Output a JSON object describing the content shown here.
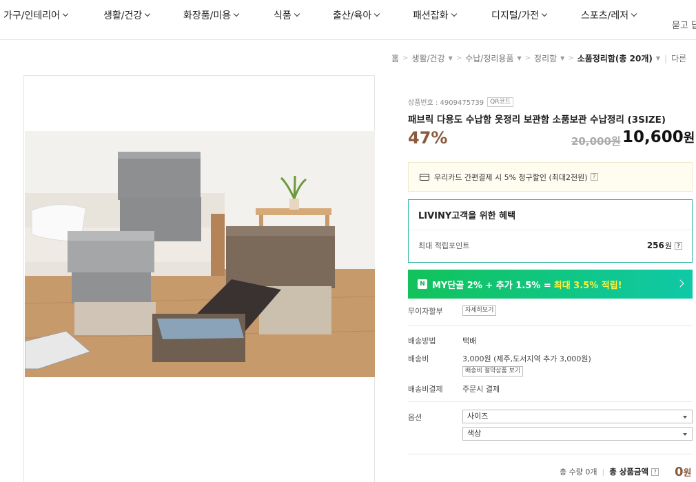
{
  "nav": {
    "items": [
      {
        "label": "가구/인테리어"
      },
      {
        "label": "생활/건강"
      },
      {
        "label": "화장품/미용"
      },
      {
        "label": "식품"
      },
      {
        "label": "출산/육아"
      },
      {
        "label": "패션잡화"
      },
      {
        "label": "디지털/가전"
      },
      {
        "label": "스포츠/레저"
      }
    ],
    "extra": "묻고 답"
  },
  "breadcrumb": {
    "home": "홈",
    "level1": "생활/건강",
    "level2": "수납/정리용품",
    "level3": "정리함",
    "current_prefix": "소품정리함(총 ",
    "current_count": "20",
    "current_suffix": "개)",
    "other": "다른"
  },
  "product": {
    "code_label": "상품번호 : 4909475739",
    "qr_label": "QR코드",
    "title": "패브릭 다용도 수납함 옷정리 보관함 소품보관 수납정리 (3SIZE)",
    "discount": "47%",
    "original_price": "20,000원",
    "price": "10,600",
    "price_unit": "원",
    "image_alt": "fabric storage boxes photo"
  },
  "card_banner": {
    "text": "우리카드 간편결제 시 5% 청구할인 (최대2천원)",
    "help": "?"
  },
  "benefit": {
    "title": "LIVINY고객을 위한 혜택",
    "points_label": "최대 적립포인트",
    "points_value": "256",
    "points_unit": "원",
    "help": "?"
  },
  "my_banner": {
    "badge": "N",
    "text": "MY단골 2% + 추가 1.5% =",
    "highlight": "최대 3.5% 적립!"
  },
  "installment": {
    "label": "무이자할부",
    "button": "자세히보기"
  },
  "shipping": {
    "method_label": "배송방법",
    "method_value": "택배",
    "fee_label": "배송비",
    "fee_value": "3,000원 (제주,도서지역 추가 3,000원)",
    "fee_button": "배송비 절약상품 보기",
    "payment_label": "배송비결제",
    "payment_value": "주문시 결제"
  },
  "options": {
    "label": "옵션",
    "select1": "사이즈",
    "select2": "색상"
  },
  "total": {
    "qty_label": "총 수량 0개",
    "amount_label": "총 상품금액",
    "help": "?",
    "amount": "0",
    "unit": "원"
  },
  "colors": {
    "accent_brown": "#8b5a3c",
    "benefit_border": "#2db39e",
    "naver_green": "#12c25a",
    "highlight_yellow": "#ffef3a"
  }
}
